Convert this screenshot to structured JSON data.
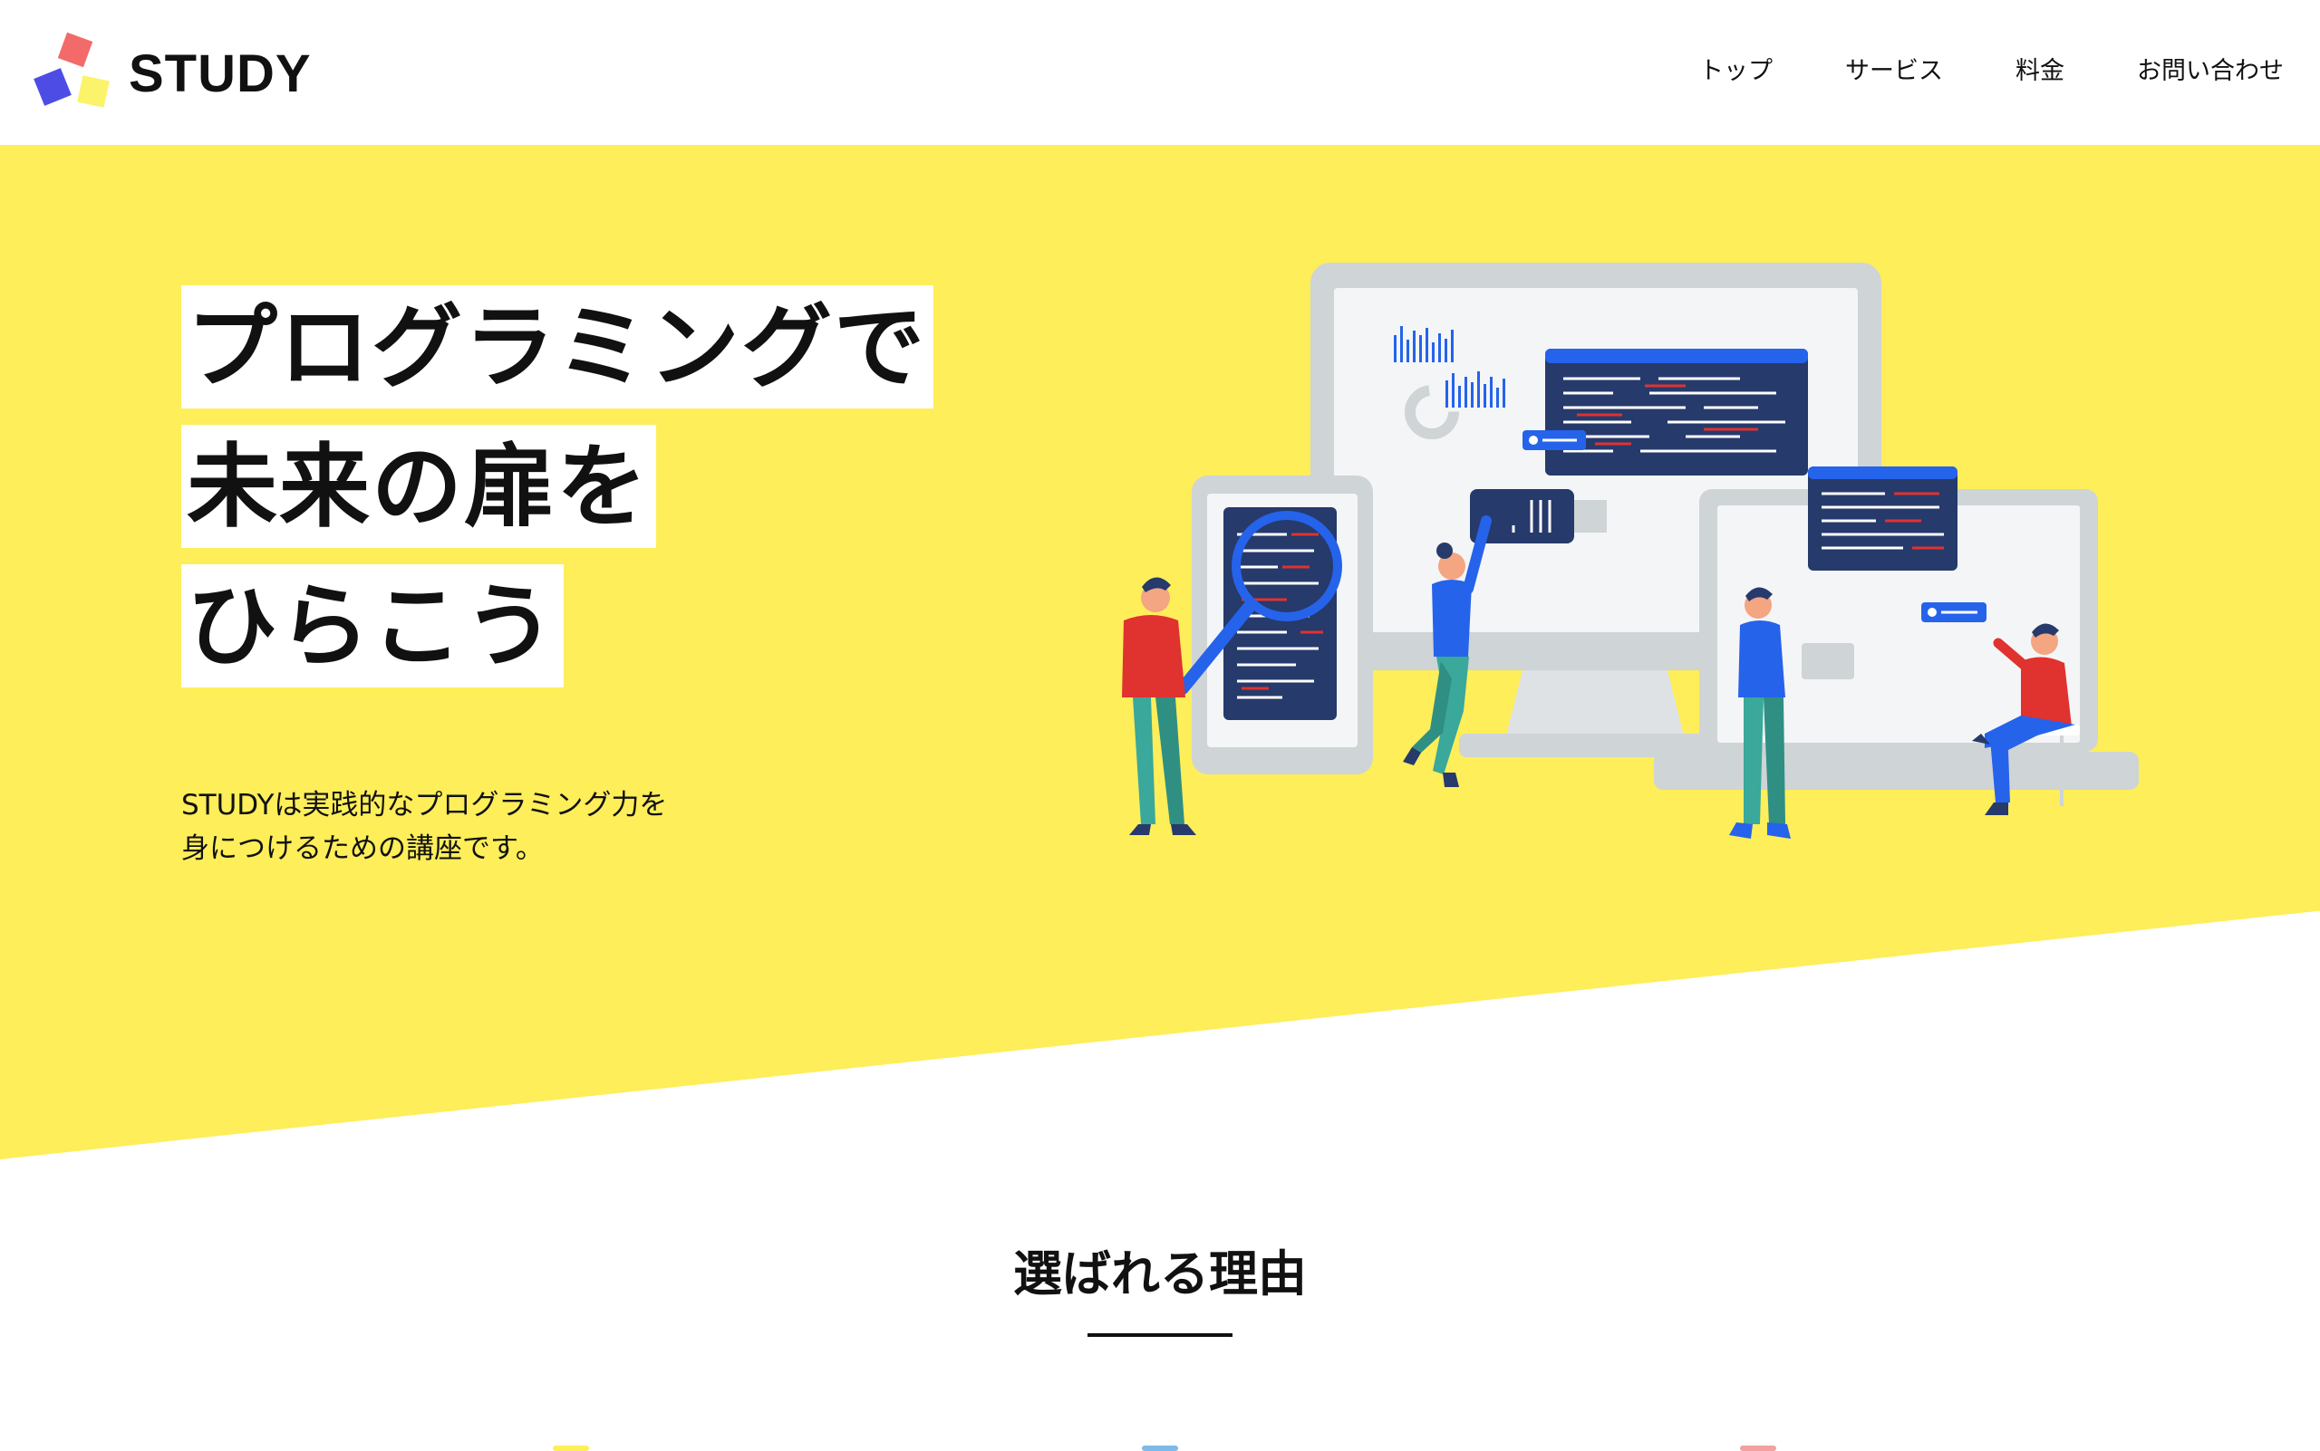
{
  "header": {
    "logo_text": "STUDY",
    "nav": [
      {
        "label": "トップ"
      },
      {
        "label": "サービス"
      },
      {
        "label": "料金"
      },
      {
        "label": "お問い合わせ"
      }
    ]
  },
  "hero": {
    "headline_lines": [
      "プログラミングで",
      "未来の扉を",
      "ひらこう"
    ],
    "lead_lines": [
      "STUDYは実践的なプログラミング力を",
      "身につけるための講座です。"
    ]
  },
  "section": {
    "title": "選ばれる理由"
  },
  "colors": {
    "hero_bg": "#fdee5a",
    "accent_blue": "#2563eb",
    "accent_red": "#e0322f",
    "logo_red": "#f26a6a",
    "logo_blue": "#4d4de6",
    "logo_yellow": "#fbf36a"
  }
}
